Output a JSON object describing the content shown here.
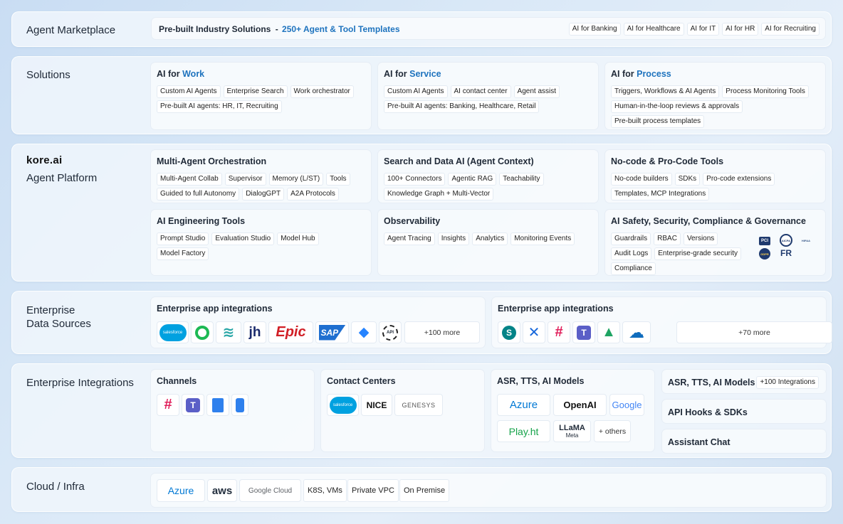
{
  "marketplace": {
    "label": "Agent Marketplace",
    "prebuilt": "Pre-built Industry Solutions",
    "dash": "-",
    "templates": "250+ Agent & Tool Templates",
    "tags": [
      "AI for Banking",
      "AI for Healthcare",
      "AI for IT",
      "AI for HR",
      "AI for Recruiting"
    ]
  },
  "solutions": {
    "label": "Solutions",
    "cards": [
      {
        "prefix": "AI for ",
        "accent": "Work",
        "tags": [
          "Custom AI Agents",
          "Enterprise Search",
          "Work orchestrator",
          "Pre-built AI agents: HR, IT, Recruiting"
        ]
      },
      {
        "prefix": "AI for ",
        "accent": "Service",
        "tags": [
          "Custom AI Agents",
          "AI contact center",
          "Agent assist",
          "Pre-built AI agents: Banking, Healthcare, Retail"
        ]
      },
      {
        "prefix": "AI for ",
        "accent": "Process",
        "tags": [
          "Triggers, Workflows  & AI Agents",
          "Process Monitoring Tools",
          "Human-in-the-loop reviews & approvals",
          "Pre-built process templates"
        ]
      }
    ]
  },
  "platform": {
    "brand": "kore.ai",
    "label": "Agent Platform",
    "cards": [
      {
        "title": "Multi-Agent Orchestration",
        "tags": [
          "Multi-Agent Collab",
          "Supervisor",
          "Memory (L/ST)",
          "Tools",
          "Guided to full Autonomy",
          "DialogGPT",
          "A2A Protocols"
        ]
      },
      {
        "title": "Search and Data AI (Agent Context)",
        "tags": [
          "100+ Connectors",
          "Agentic RAG",
          "Teachability",
          "Knowledge Graph + Multi-Vector"
        ]
      },
      {
        "title": "No-code & Pro-Code Tools",
        "tags": [
          "No-code builders",
          "SDKs",
          "Pro-code extensions",
          "Templates, MCP Integrations"
        ]
      },
      {
        "title": "AI Engineering Tools",
        "tags": [
          "Prompt Studio",
          "Evaluation Studio",
          "Model Hub",
          "Model Factory"
        ]
      },
      {
        "title": "Observability",
        "tags": [
          "Agent Tracing",
          "Insights",
          "Analytics",
          "Monitoring Events"
        ]
      },
      {
        "title": "AI Safety, Security, Compliance  & Governance",
        "tags": [
          "Guardrails",
          "RBAC",
          "Versions",
          "Audit Logs",
          "Enterprise-grade security",
          "Compliance"
        ]
      }
    ],
    "cert_badges": [
      "PCI",
      "AICPA",
      "HIPAA",
      "GDPR",
      "FR"
    ]
  },
  "data_sources": {
    "label_line1": "Enterprise",
    "label_line2": "Data Sources",
    "cards": [
      {
        "title": "Enterprise app integrations",
        "logos": [
          "salesforce",
          "Q",
          "≋",
          "jh",
          "Epic",
          "SAP",
          "◆",
          "API"
        ],
        "more": "+100 more"
      },
      {
        "title": "Enterprise app integrations",
        "logos": [
          "S",
          "✕",
          "#",
          "T",
          "▲",
          "☁"
        ],
        "more": "+70 more"
      }
    ]
  },
  "integrations": {
    "label": "Enterprise Integrations",
    "channels": {
      "title": "Channels"
    },
    "contact_centers": {
      "title": "Contact Centers",
      "logos": [
        "salesforce",
        "NICE",
        "GENESYS"
      ]
    },
    "asr": {
      "title": "ASR, TTS, AI Models",
      "logos": [
        "Azure",
        "OpenAI",
        "Google",
        "Play.ht",
        "LLaMA",
        "Meta"
      ],
      "others": "+ others"
    },
    "side": {
      "asr_title": "ASR, TTS, AI Models",
      "asr_tag": "+100 Integrations",
      "api_title": "API Hooks & SDKs",
      "chat_title": "Assistant Chat"
    }
  },
  "cloud": {
    "label": "Cloud / Infra",
    "azure": "Azure",
    "aws": "aws",
    "google": "Google Cloud",
    "tags": [
      "K8S, VMs",
      "Private VPC",
      "On Premise"
    ]
  },
  "colors": {
    "accent": "#1e73be",
    "background": "#d6e6f6",
    "card": "#f7fafd"
  }
}
